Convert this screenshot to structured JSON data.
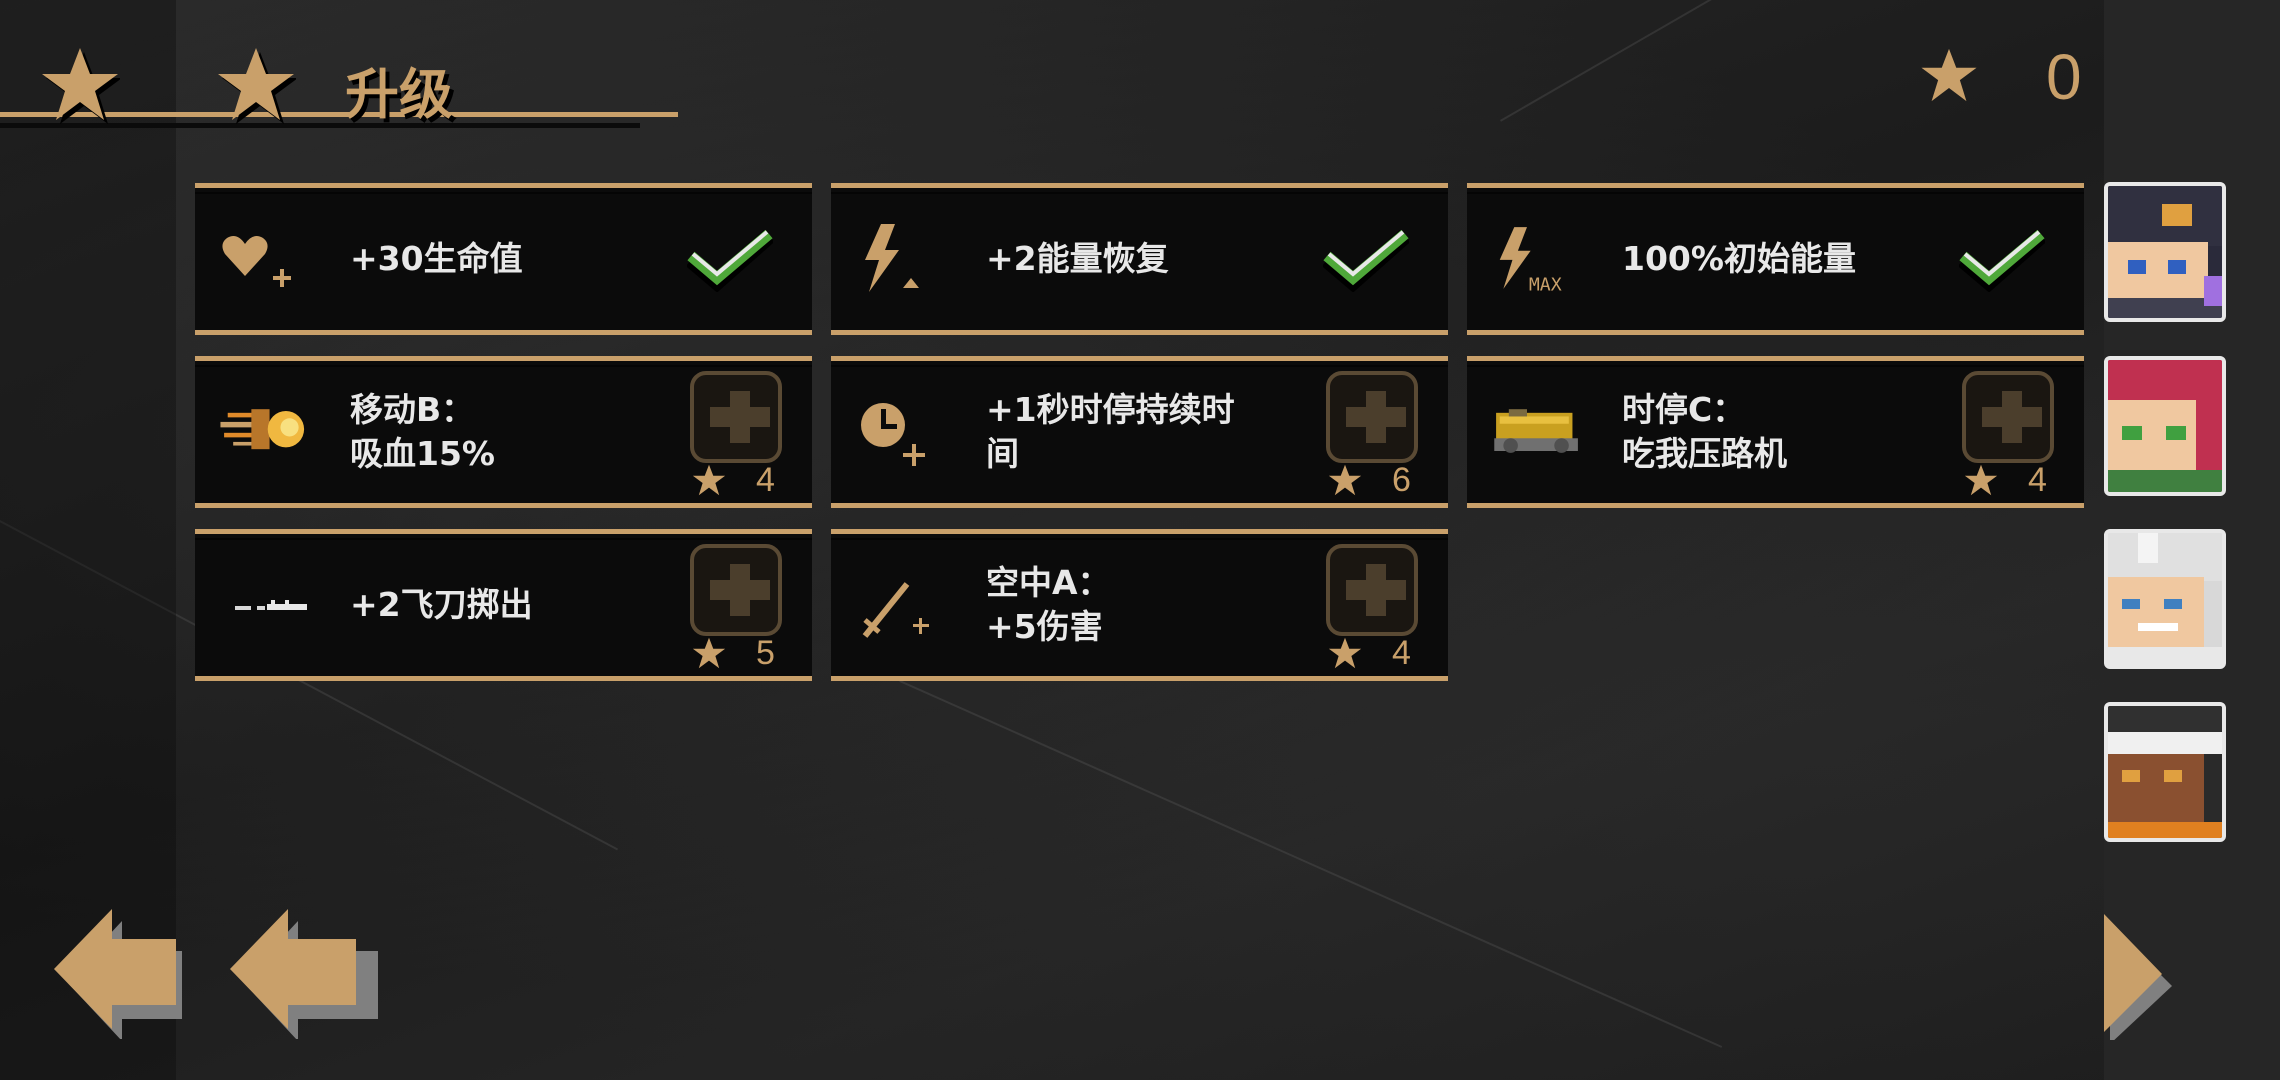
{
  "header": {
    "title": "升级",
    "stars_available": "0"
  },
  "colors": {
    "accent": "#c9a06a",
    "check": "#4fa83a",
    "panel": "#0b0b0b",
    "text": "#e8e8e8"
  },
  "upgrades": [
    {
      "label": "+30生命值",
      "icon": "heart-plus-icon",
      "purchased": true
    },
    {
      "label": "+2能量恢复",
      "icon": "lightning-up-icon",
      "purchased": true
    },
    {
      "label": "100%初始能量",
      "icon": "lightning-max-icon",
      "icon_text": "MAX",
      "purchased": true
    },
    {
      "label": "移动B：\n吸血15%",
      "icon": "fireball-icon",
      "purchased": false,
      "cost": "4"
    },
    {
      "label": "+1秒时停持续时\n间",
      "icon": "clock-plus-icon",
      "purchased": false,
      "cost": "6"
    },
    {
      "label": "时停C：\n吃我压路机",
      "icon": "road-roller-icon",
      "purchased": false,
      "cost": "4"
    },
    {
      "label": "+2飞刀掷出",
      "icon": "knife-icon",
      "purchased": false,
      "cost": "5"
    },
    {
      "label": "空中A：\n+5伤害",
      "icon": "sword-plus-icon",
      "purchased": false,
      "cost": "4"
    }
  ],
  "characters": [
    "portrait-1",
    "portrait-2",
    "portrait-3",
    "portrait-4"
  ],
  "navigation": {
    "back_icon": "back-arrow-icon",
    "next_icon": "next-arrow-icon"
  }
}
